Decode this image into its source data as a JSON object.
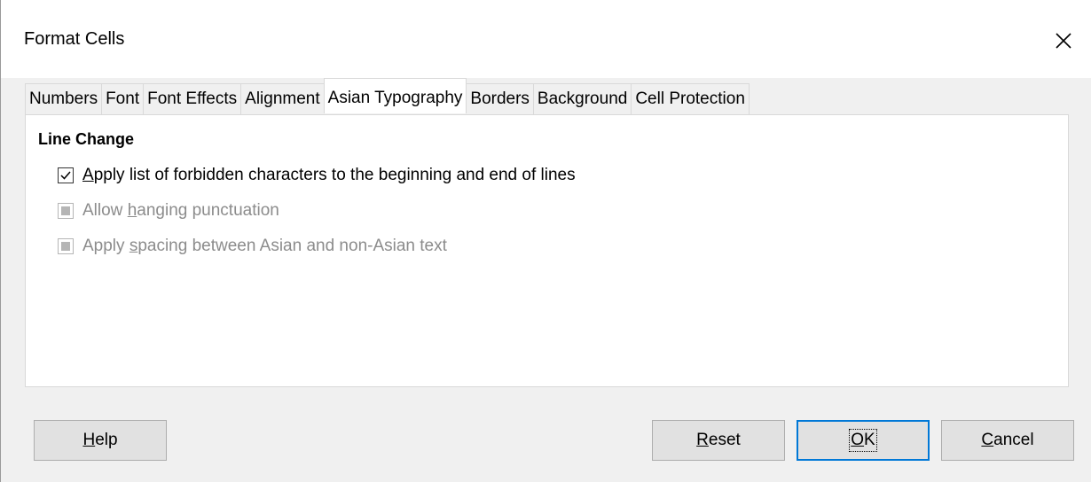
{
  "window": {
    "title": "Format Cells",
    "close_icon": "close-icon"
  },
  "tabs": [
    {
      "label": "Numbers",
      "active": false
    },
    {
      "label": "Font",
      "active": false
    },
    {
      "label": "Font Effects",
      "active": false
    },
    {
      "label": "Alignment",
      "active": false
    },
    {
      "label": "Asian Typography",
      "active": true
    },
    {
      "label": "Borders",
      "active": false
    },
    {
      "label": "Background",
      "active": false
    },
    {
      "label": "Cell Protection",
      "active": false
    }
  ],
  "panel": {
    "section_title": "Line Change",
    "options": [
      {
        "pre": "",
        "accel": "A",
        "post": "pply list of forbidden characters to the beginning and end of lines",
        "checked": true,
        "enabled": true
      },
      {
        "pre": "Allow ",
        "accel": "h",
        "post": "anging punctuation",
        "checked": false,
        "enabled": false
      },
      {
        "pre": "Apply ",
        "accel": "s",
        "post": "pacing between Asian and non-Asian text",
        "checked": false,
        "enabled": false
      }
    ]
  },
  "buttons": {
    "help": {
      "accel": "H",
      "rest": "elp"
    },
    "reset": {
      "accel": "R",
      "rest": "eset"
    },
    "ok": {
      "accel": "O",
      "rest": "K"
    },
    "cancel": {
      "accel": "C",
      "rest": "ancel"
    }
  },
  "colors": {
    "accent": "#0078d7",
    "disabled_text": "#8c8c8c"
  }
}
